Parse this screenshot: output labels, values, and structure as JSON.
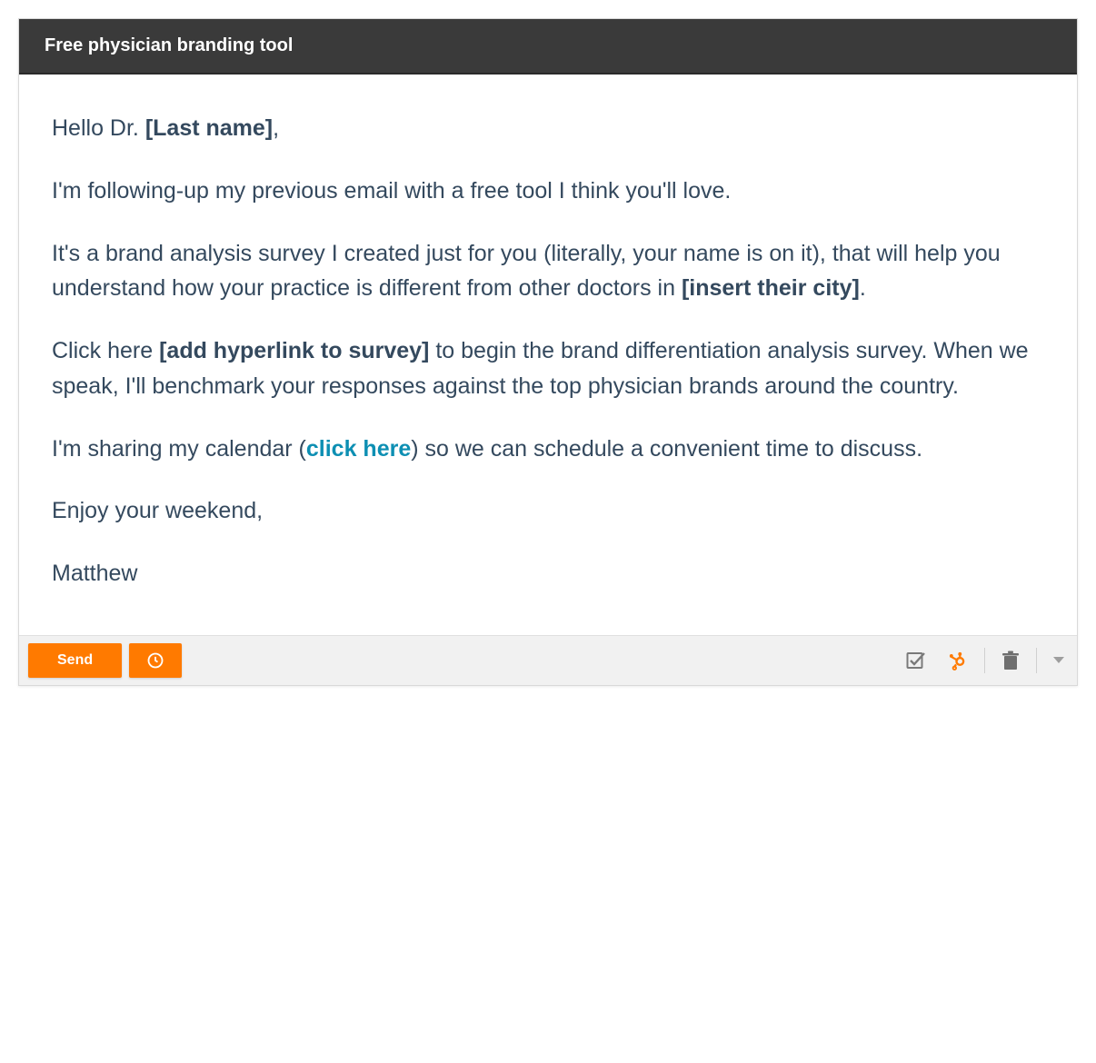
{
  "header": {
    "subject": "Free physician branding tool"
  },
  "body": {
    "greeting": {
      "pre": "Hello Dr. ",
      "placeholder": "[Last name]",
      "post": ","
    },
    "p1": "I'm following-up my previous email with a free tool I think you'll love.",
    "p2": {
      "pre": "It's a brand analysis survey I created just for you (literally, your name is on it), that will help you understand how your practice is different from other doctors in ",
      "placeholder": "[insert their city]",
      "post": "."
    },
    "p3": {
      "pre": "Click here ",
      "placeholder": "[add hyperlink to survey]",
      "post": " to begin the brand differentiation analysis survey. When we speak, I'll benchmark your responses against the top physician brands around the country."
    },
    "p4": {
      "pre": "I'm sharing my calendar (",
      "link": "click here",
      "post": ") so we can schedule a convenient time to discuss."
    },
    "closing": "Enjoy your weekend,",
    "signature": "Matthew"
  },
  "footer": {
    "send_label": "Send"
  }
}
